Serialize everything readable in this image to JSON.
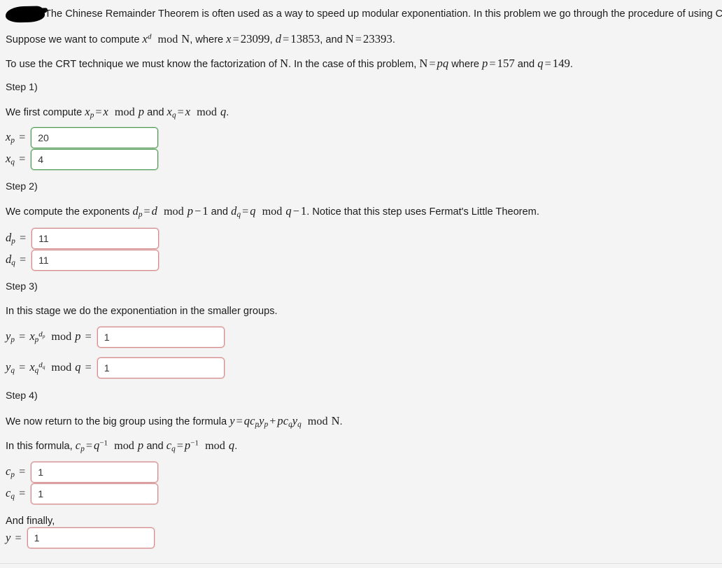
{
  "document": {
    "intro": "The Chinese Remainder Theorem is often used as a way to speed up modular exponentiation. In this problem we go through the procedure of using CRT.",
    "redaction": "redacted-marker"
  },
  "problem": {
    "suppose_prefix": "Suppose we want to compute",
    "suppose_mid": ", where",
    "x_label": "x",
    "x_value": "23099",
    "d_label": "d",
    "d_value": "13853",
    "and_word": "and",
    "N_label": "N",
    "N_value": "23393",
    "factor_prefix": "To use the CRT technique we must know the factorization of",
    "factor_mid": ". In the case of this problem,",
    "factor_eq": "N = pq",
    "where_word": "where",
    "p_label": "p",
    "p_value": "157",
    "q_label": "q",
    "q_value": "149",
    "period": "."
  },
  "steps": [
    {
      "heading": "Step 1)",
      "description_prefix": "We first compute",
      "description_mid": "and",
      "fields": [
        {
          "name": "xp",
          "label_base": "x",
          "label_sub": "p",
          "value": "20",
          "state": "ok"
        },
        {
          "name": "xq",
          "label_base": "x",
          "label_sub": "q",
          "value": "4",
          "state": "ok"
        }
      ]
    },
    {
      "heading": "Step 2)",
      "description_prefix": "We compute the exponents",
      "description_mid": "and",
      "description_suffix": ". Notice that this step uses Fermat's Little Theorem.",
      "fields": [
        {
          "name": "dp",
          "label_base": "d",
          "label_sub": "p",
          "value": "11",
          "state": "bad"
        },
        {
          "name": "dq",
          "label_base": "d",
          "label_sub": "q",
          "value": "11",
          "state": "bad"
        }
      ]
    },
    {
      "heading": "Step 3)",
      "description": "In this stage we do the exponentiation in the smaller groups.",
      "fields": [
        {
          "name": "yp",
          "value": "1",
          "state": "bad"
        },
        {
          "name": "yq",
          "value": "1",
          "state": "bad"
        }
      ]
    },
    {
      "heading": "Step 4)",
      "description_line1_prefix": "We now return to the big group using the formula",
      "description_line2_prefix": "In this formula,",
      "description_line2_mid": "and",
      "fields": [
        {
          "name": "cp",
          "label_base": "c",
          "label_sub": "p",
          "value": "1",
          "state": "bad"
        },
        {
          "name": "cq",
          "label_base": "c",
          "label_sub": "q",
          "value": "1",
          "state": "bad"
        }
      ],
      "final_label": "And finally,",
      "final_field": {
        "name": "y",
        "label_base": "y",
        "value": "1",
        "state": "bad"
      }
    }
  ],
  "colors": {
    "page_background": "#f4f4f4",
    "input_background": "#ffffff",
    "valid_border": "#4f9a52",
    "invalid_border": "#d58b8b",
    "text": "#1c1c1c",
    "rule": "#dedede"
  }
}
